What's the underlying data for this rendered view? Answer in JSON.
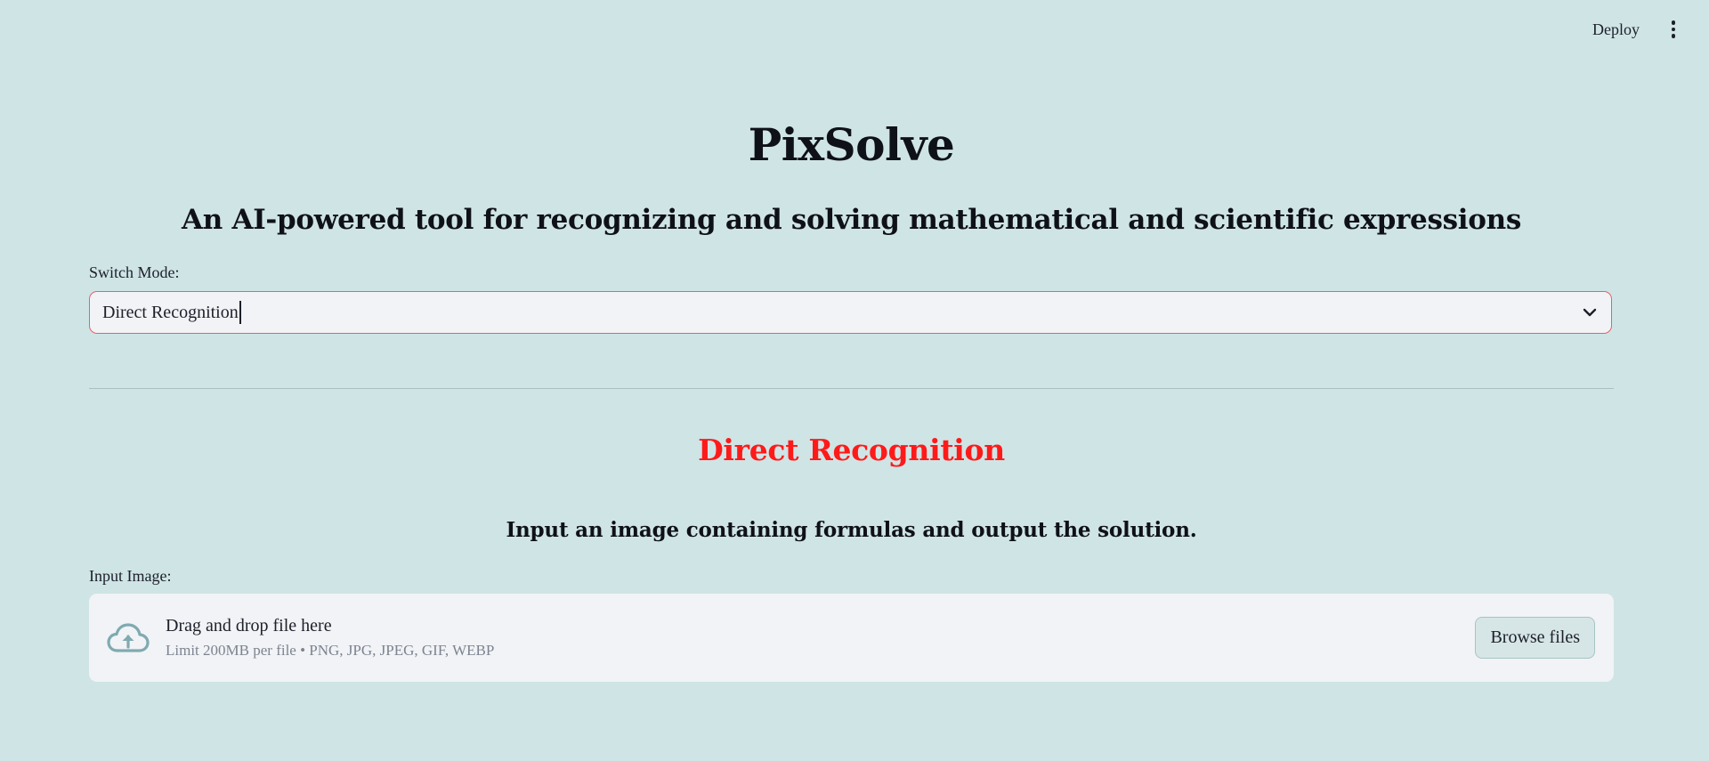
{
  "header": {
    "deploy_label": "Deploy",
    "menu_icon": "kebab-menu-icon"
  },
  "main": {
    "title": "PixSolve",
    "subtitle": "An AI-powered tool for recognizing and solving mathematical and scientific expressions",
    "mode_select": {
      "label": "Switch Mode:",
      "value": "Direct Recognition",
      "icon": "chevron-down-icon"
    },
    "section": {
      "title": "Direct Recognition",
      "title_color": "#ff1a1a",
      "description": "Input an image containing formulas and output the solution."
    },
    "uploader": {
      "label": "Input Image:",
      "drop_text": "Drag and drop file here",
      "limit_text": "Limit 200MB per file • PNG, JPG, JPEG, GIF, WEBP",
      "browse_label": "Browse files",
      "icon": "cloud-upload-icon"
    }
  },
  "colors": {
    "background": "#cfe4e5",
    "input_background": "#f1f3f6",
    "select_border": "#e8606a",
    "upload_icon": "#7faab0"
  }
}
